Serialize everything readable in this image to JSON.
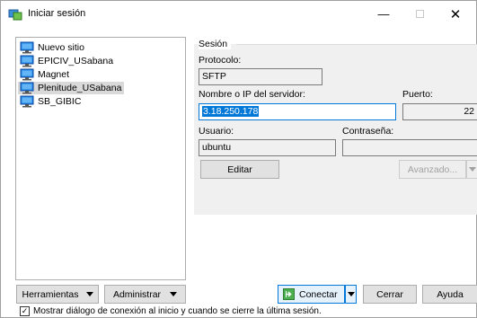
{
  "window": {
    "title": "Iniciar sesión",
    "minimize": "—",
    "close": "✕"
  },
  "sites": [
    {
      "label": "Nuevo sitio",
      "selected": false
    },
    {
      "label": "EPICIV_USabana",
      "selected": false
    },
    {
      "label": "Magnet",
      "selected": false
    },
    {
      "label": "Plenitude_USabana",
      "selected": true
    },
    {
      "label": "SB_GIBIC",
      "selected": false
    }
  ],
  "session": {
    "group_title": "Sesión",
    "protocol_label": "Protocolo:",
    "protocol_value": "SFTP",
    "host_label": "Nombre o IP del servidor:",
    "host_value": "3.18.250.178",
    "port_label": "Puerto:",
    "port_value": "22",
    "user_label": "Usuario:",
    "user_value": "ubuntu",
    "password_label": "Contraseña:",
    "password_value": "",
    "edit_button": "Editar",
    "advanced_button": "Avanzado..."
  },
  "footer": {
    "tools_button": "Herramientas",
    "manage_button": "Administrar",
    "connect_button": "Conectar",
    "close_button": "Cerrar",
    "help_button": "Ayuda",
    "checkbox_checked": true,
    "checkbox_label": "Mostrar diálogo de conexión al inicio y cuando se cierre la última sesión."
  },
  "colors": {
    "accent": "#0078d7",
    "panel": "#f0f0f0",
    "selection": "#d9d9d9"
  }
}
